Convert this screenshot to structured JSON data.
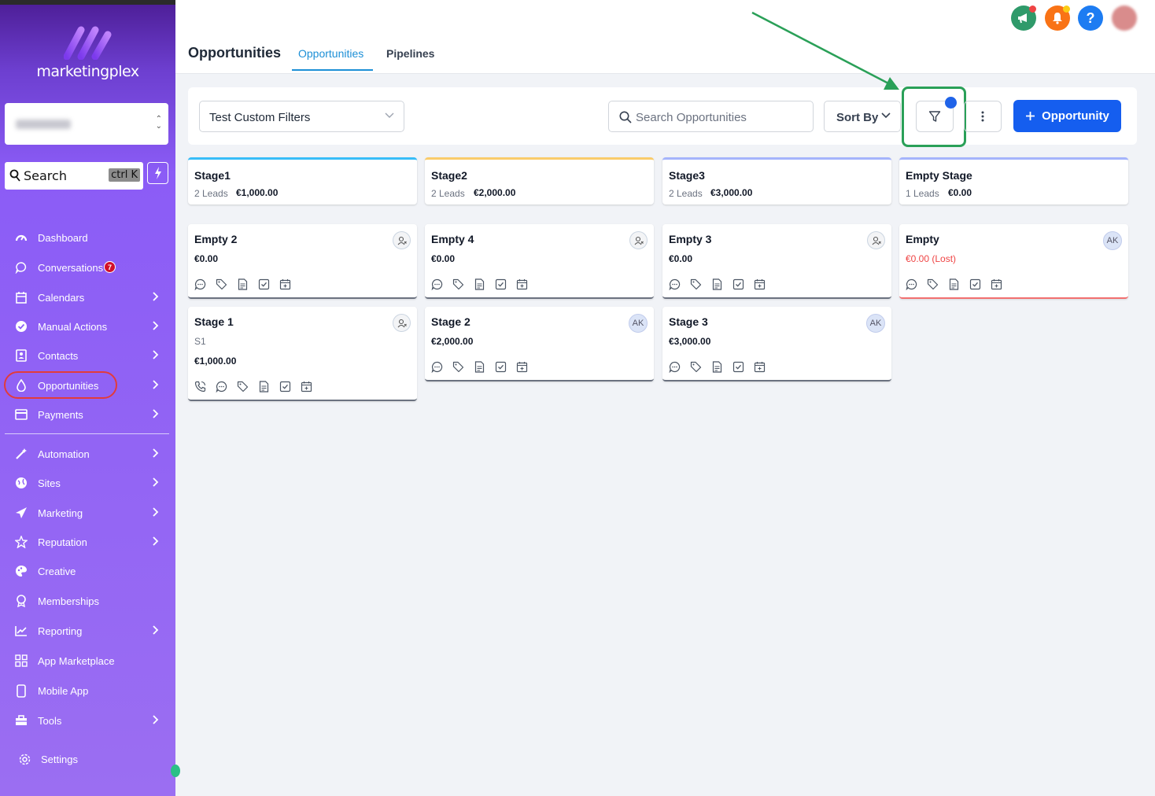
{
  "brand": {
    "name": "marketingplex"
  },
  "sidebar": {
    "search_label": "Search",
    "search_shortcut": "ctrl K",
    "items": [
      {
        "label": "Dashboard",
        "icon": "dashboard-icon"
      },
      {
        "label": "Conversations",
        "icon": "chat-icon",
        "badge": "7"
      },
      {
        "label": "Calendars",
        "icon": "calendar-icon"
      },
      {
        "label": "Manual Actions",
        "icon": "check-circle-icon"
      },
      {
        "label": "Contacts",
        "icon": "contacts-icon"
      },
      {
        "label": "Opportunities",
        "icon": "opportunity-icon"
      },
      {
        "label": "Payments",
        "icon": "payments-icon"
      },
      {
        "label": "Automation",
        "icon": "wand-icon"
      },
      {
        "label": "Sites",
        "icon": "globe-icon"
      },
      {
        "label": "Marketing",
        "icon": "send-icon"
      },
      {
        "label": "Reputation",
        "icon": "star-icon"
      },
      {
        "label": "Creative",
        "icon": "palette-icon"
      },
      {
        "label": "Memberships",
        "icon": "award-icon"
      },
      {
        "label": "Reporting",
        "icon": "chart-icon"
      },
      {
        "label": "App Marketplace",
        "icon": "grid-icon"
      },
      {
        "label": "Mobile App",
        "icon": "phone-icon"
      },
      {
        "label": "Tools",
        "icon": "toolbox-icon"
      },
      {
        "label": "Settings",
        "icon": "gear-icon"
      }
    ]
  },
  "header": {
    "title": "Opportunities",
    "tabs": [
      {
        "label": "Opportunities"
      },
      {
        "label": "Pipelines"
      }
    ]
  },
  "toolbar": {
    "pipeline_select": "Test Custom Filters",
    "search_placeholder": "Search Opportunities",
    "sort_label": "Sort By",
    "add_label": "Opportunity"
  },
  "stages": [
    {
      "name": "Stage1",
      "leads": "2 Leads",
      "amount": "€1,000.00",
      "color": "#38bdf8"
    },
    {
      "name": "Stage2",
      "leads": "2 Leads",
      "amount": "€2,000.00",
      "color": "#facc6b"
    },
    {
      "name": "Stage3",
      "leads": "2 Leads",
      "amount": "€3,000.00",
      "color": "#a5b4fc"
    },
    {
      "name": "Empty Stage",
      "leads": "1 Leads",
      "amount": "€0.00",
      "color": "#a5b4fc"
    }
  ],
  "cards": [
    {
      "name": "Empty 2",
      "value": "€0.00"
    },
    {
      "name": "Empty 4",
      "value": "€0.00"
    },
    {
      "name": "Empty 3",
      "value": "€0.00"
    },
    {
      "name": "Empty",
      "value": "€0.00 (Lost)",
      "avatar": "AK"
    },
    {
      "name": "Stage 1",
      "sub": "S1",
      "value": "€1,000.00"
    },
    {
      "name": "Stage 2",
      "value": "€2,000.00",
      "avatar": "AK"
    },
    {
      "name": "Stage 3",
      "value": "€3,000.00",
      "avatar": "AK"
    }
  ],
  "colors": {
    "accent": "#155eef",
    "highlight": "#2aa058",
    "lost": "#ef4444"
  }
}
